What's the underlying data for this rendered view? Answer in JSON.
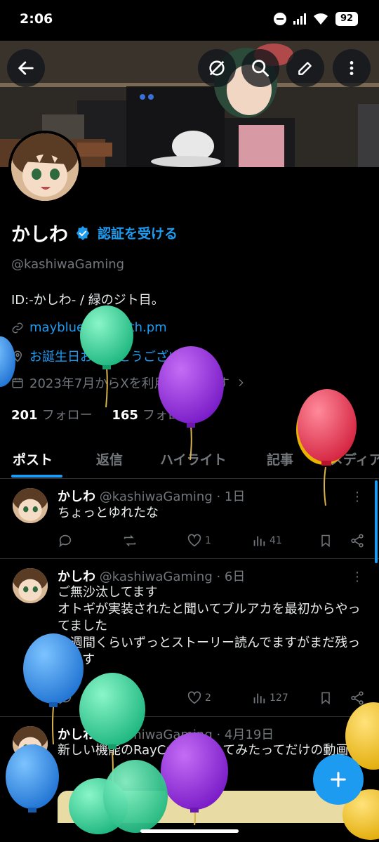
{
  "status_bar": {
    "time": "2:06",
    "battery": "92"
  },
  "colors": {
    "accent": "#1d9bf0",
    "background": "#000000",
    "secondary_text": "#71767b"
  },
  "header": {
    "back_icon": "arrow-left-icon",
    "actions": [
      "translate-icon",
      "search-icon",
      "edit-icon",
      "more-vertical-icon"
    ]
  },
  "profile": {
    "name": "かしわ",
    "verify_label": "認証を受ける",
    "handle": "@kashiwaGaming",
    "bio": "ID:-かしわ- / 緑のジト目。",
    "link": "mayblues-s.booth.pm",
    "location": "お誕生日おめでとうございます。",
    "joined": "2023年7月からXを利用しています",
    "following_count": "201",
    "following_label": "フォロー",
    "followers_count": "165",
    "followers_label": "フォロワー"
  },
  "tabs": [
    "ポスト",
    "返信",
    "ハイライト",
    "記事",
    "メディア"
  ],
  "posts": [
    {
      "name": "かしわ",
      "meta": "@kashiwaGaming · 1日",
      "text": "ちょっとゆれたな",
      "likes": "1",
      "views": "41"
    },
    {
      "name": "かしわ",
      "meta": "@kashiwaGaming · 6日",
      "text": "ご無沙汰してます\nオトギが実装されたと聞いてブルアカを最初からやってました\n一週間くらいずっとストーリー読んでますがまだ残ってます",
      "likes": "2",
      "views": "127"
    },
    {
      "name": "かしわ",
      "meta": "@kashiwaGaming · 4月19日",
      "text": "新しい機能のRayCastを試してみたってだけの動画"
    }
  ],
  "fab": {
    "icon": "plus-icon"
  }
}
